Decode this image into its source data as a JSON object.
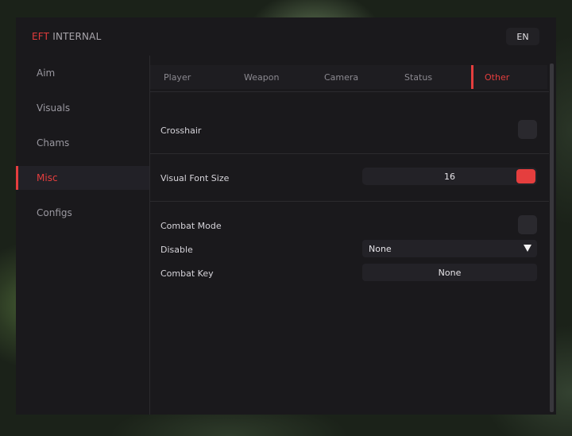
{
  "brand": {
    "accent": "EFT",
    "name": "INTERNAL"
  },
  "language": "EN",
  "sidebar": {
    "items": [
      {
        "label": "Aim"
      },
      {
        "label": "Visuals"
      },
      {
        "label": "Chams"
      },
      {
        "label": "Misc",
        "active": true
      },
      {
        "label": "Configs"
      }
    ]
  },
  "tabs": [
    {
      "label": "Player"
    },
    {
      "label": "Weapon"
    },
    {
      "label": "Camera"
    },
    {
      "label": "Status"
    },
    {
      "label": "Other",
      "active": true
    }
  ],
  "settings": {
    "crosshair": {
      "label": "Crosshair",
      "checked": false
    },
    "visual_font_size": {
      "label": "Visual Font Size",
      "value": "16"
    },
    "combat_mode": {
      "label": "Combat Mode",
      "checked": false
    },
    "disable": {
      "label": "Disable",
      "value": "None"
    },
    "combat_key": {
      "label": "Combat Key",
      "value": "None"
    }
  },
  "colors": {
    "accent": "#e53e3e",
    "background": "#1a191c",
    "panel": "#232227"
  }
}
